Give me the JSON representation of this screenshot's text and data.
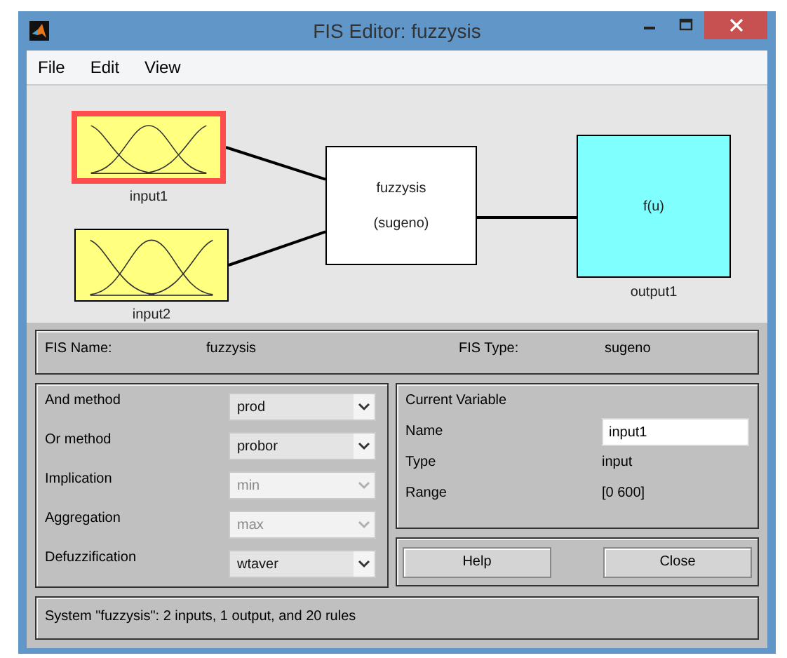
{
  "window": {
    "title": "FIS Editor: fuzzysis"
  },
  "menu": [
    "File",
    "Edit",
    "View"
  ],
  "diagram": {
    "inputs": [
      {
        "label": "input1",
        "selected": true
      },
      {
        "label": "input2",
        "selected": false
      }
    ],
    "system": {
      "name": "fuzzysis",
      "type": "(sugeno)"
    },
    "outputs": [
      {
        "label": "output1",
        "function": "f(u)",
        "selected": false
      }
    ]
  },
  "fis_info": {
    "name_label": "FIS Name:",
    "name": "fuzzysis",
    "type_label": "FIS Type:",
    "type": "sugeno"
  },
  "methods": [
    {
      "label": "And method",
      "value": "prod",
      "disabled": false
    },
    {
      "label": "Or method",
      "value": "probor",
      "disabled": false
    },
    {
      "label": "Implication",
      "value": "min",
      "disabled": true
    },
    {
      "label": "Aggregation",
      "value": "max",
      "disabled": true
    },
    {
      "label": "Defuzzification",
      "value": "wtaver",
      "disabled": false
    }
  ],
  "current_variable": {
    "title": "Current Variable",
    "name_label": "Name",
    "name": "input1",
    "type_label": "Type",
    "type": "input",
    "range_label": "Range",
    "range": "[0 600]"
  },
  "buttons": [
    "Help",
    "Close"
  ],
  "status": "System \"fuzzysis\": 2 inputs, 1 output, and 20 rules"
}
